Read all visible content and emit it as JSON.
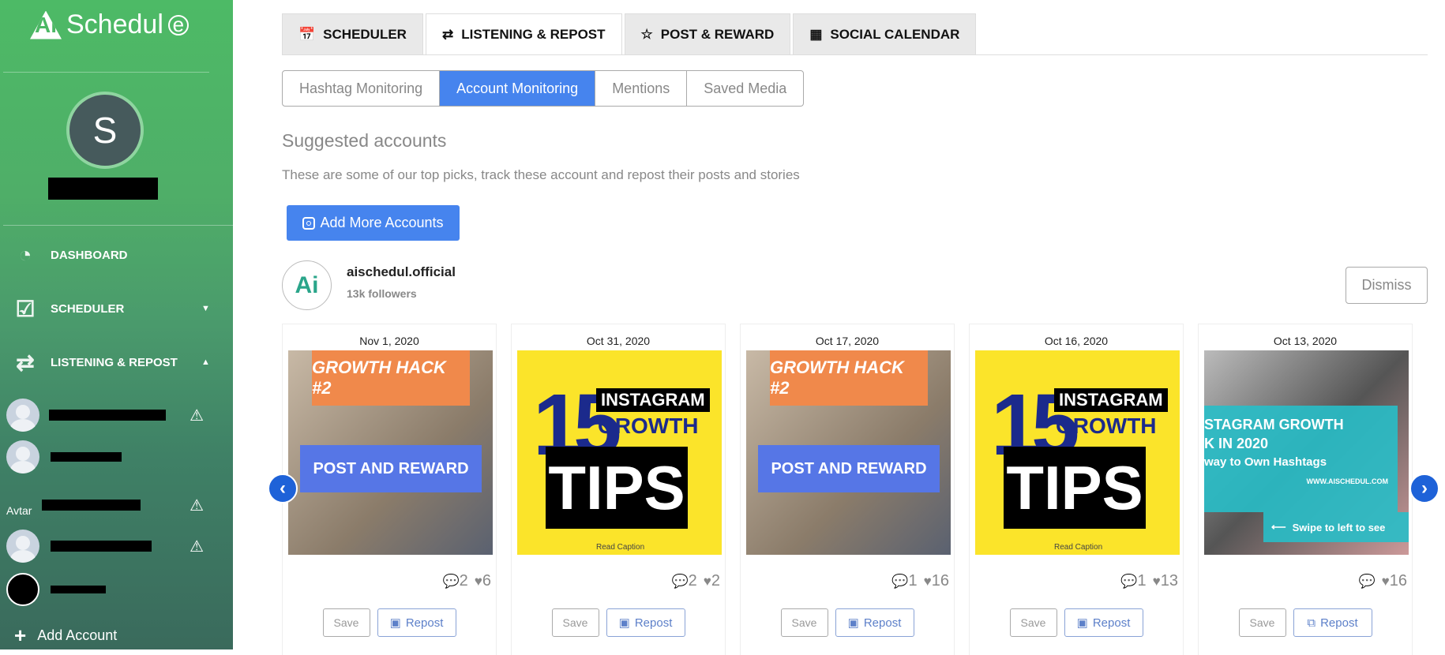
{
  "brand": {
    "logo_text": "Schedul",
    "accent": "#4684ee",
    "sidebar_green": "#4cb865"
  },
  "sidebar": {
    "avatar_initial": "S",
    "nav": [
      {
        "label": "DASHBOARD",
        "icon": "pie-chart-icon"
      },
      {
        "label": "SCHEDULER",
        "icon": "calendar-check-icon",
        "caret": "▼"
      },
      {
        "label": "LISTENING & REPOST",
        "icon": "repeat-icon",
        "caret": "▲"
      }
    ],
    "broken_avatar_alt": "Avtar",
    "add_account": "Add Account"
  },
  "tabs": [
    {
      "label": "SCHEDULER",
      "icon": "calendar-icon"
    },
    {
      "label": "LISTENING & REPOST",
      "icon": "repeat-icon",
      "active": true
    },
    {
      "label": "POST & REWARD",
      "icon": "star-icon"
    },
    {
      "label": "SOCIAL CALENDAR",
      "icon": "calendar-day-icon"
    }
  ],
  "subtabs": [
    {
      "label": "Hashtag Monitoring"
    },
    {
      "label": "Account Monitoring",
      "active": true
    },
    {
      "label": "Mentions"
    },
    {
      "label": "Saved Media"
    }
  ],
  "section": {
    "title": "Suggested accounts",
    "description": "These are some of our top picks, track these account and repost their posts and stories",
    "add_button": "Add More Accounts"
  },
  "account": {
    "name": "aischedul.official",
    "followers": "13k followers",
    "dismiss": "Dismiss"
  },
  "posts": [
    {
      "date": "Nov 1, 2020",
      "comments": "2",
      "likes": "6"
    },
    {
      "date": "Oct 31, 2020",
      "comments": "2",
      "likes": "2"
    },
    {
      "date": "Oct 17, 2020",
      "comments": "1",
      "likes": "16"
    },
    {
      "date": "Oct 16, 2020",
      "comments": "1",
      "likes": "13"
    },
    {
      "date": "Oct 13, 2020",
      "comments": "",
      "likes": "16"
    }
  ],
  "post_images": {
    "growth_hack": {
      "top": "GROWTH HACK #2",
      "banner": "POST AND REWARD"
    },
    "tips": {
      "number": "15",
      "line1": "INSTAGRAM",
      "line2": "GROWTH",
      "line3": "TIPS",
      "caption": "Read Caption"
    },
    "instagram": {
      "line1": "STAGRAM GROWTH",
      "line2": "K  IN 2020",
      "line3": "way to Own Hashtags",
      "url": "WWW.AISCHEDUL.COM",
      "swipe": "Swipe to left to see"
    }
  },
  "post_actions": {
    "save": "Save",
    "repost": "Repost"
  }
}
